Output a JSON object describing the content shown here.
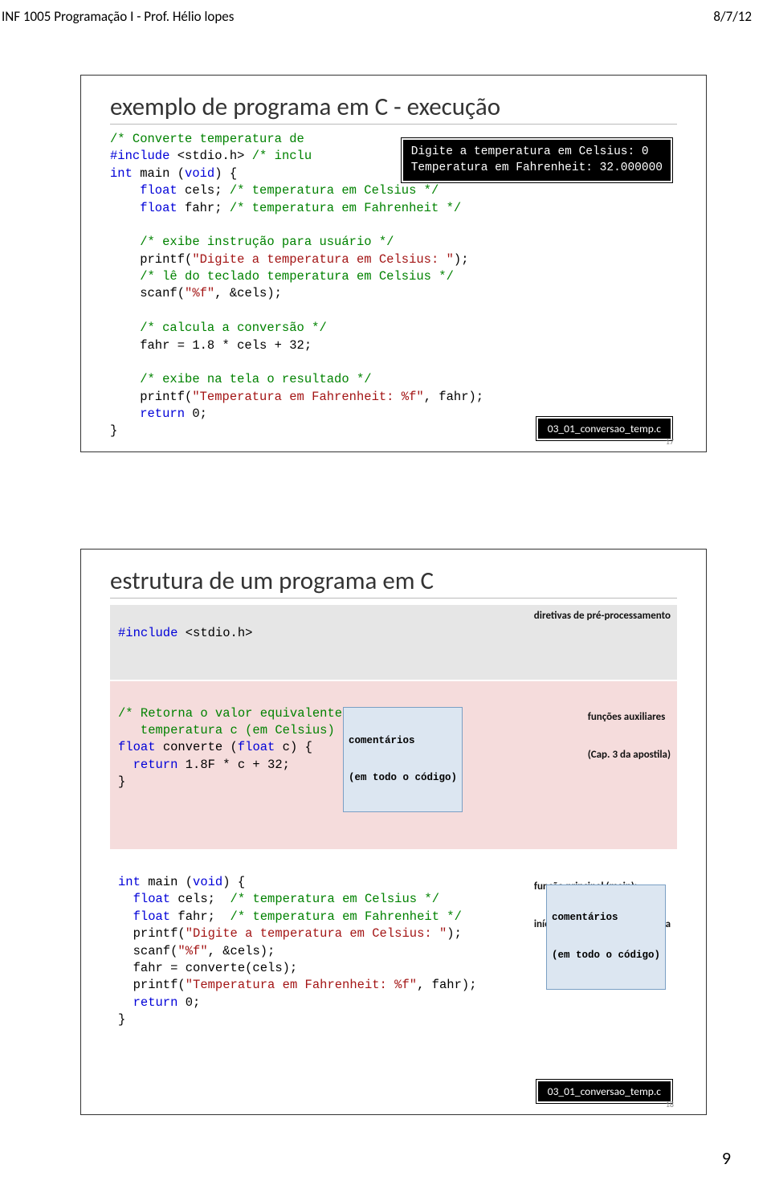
{
  "header": {
    "left": "INF 1005 Programação I - Prof. Hélio lopes",
    "right": "8/7/12"
  },
  "slide1": {
    "title": "exemplo de programa em C - execução",
    "out_line1": "Digite a temperatura em Celsius: 0",
    "out_line2": "Temperatura em Fahrenheit: 32.000000",
    "l1_cmt": "/* Converte temperatura de",
    "l2a": "#include",
    "l2b": " <stdio.h> ",
    "l2c": "/* inclu",
    "l3a": "int",
    "l3b": " main (",
    "l3c": "void",
    "l3d": ") {",
    "l4a": "    float",
    "l4b": " cels; ",
    "l4c": "/* temperatura em Celsius */",
    "l5a": "    float",
    "l5b": " fahr; ",
    "l5c": "/* temperatura em Fahrenheit */",
    "l6": " ",
    "l7": "    /* exibe instrução para usuário */",
    "l8a": "    printf(",
    "l8b": "\"Digite a temperatura em Celsius: \"",
    "l8c": ");",
    "l9": "    /* lê do teclado temperatura em Celsius */",
    "l10a": "    scanf(",
    "l10b": "\"%f\"",
    "l10c": ", &cels);",
    "l11": " ",
    "l12": "    /* calcula a conversão */",
    "l13": "    fahr = 1.8 * cels + 32;",
    "l14": " ",
    "l15": "    /* exibe na tela o resultado */",
    "l16a": "    printf(",
    "l16b": "\"Temperatura em Fahrenheit: %f\"",
    "l16c": ", fahr);",
    "l17a": "    return",
    "l17b": " 0;",
    "l18": "}",
    "fn": "03_01_conversao_temp.c",
    "pgnum": "17"
  },
  "slide2": {
    "title": "estrutura de um programa em C",
    "b1a": "#include",
    "b1b": " <stdio.h>",
    "anno1": "diretivas de pré-processamento",
    "b2_l1": "/* Retorna o valor equivalente em Fahrenheit à",
    "b2_l2": "   temperatura c (em Celsius) */",
    "b2_l3a": "float",
    "b2_l3b": " converte (",
    "b2_l3c": "float",
    "b2_l3d": " c) {",
    "b2_l4a": "  return",
    "b2_l4b": " 1.8F * c + 32;",
    "b2_l5": "}",
    "anno2_l1": "funções auxiliares",
    "anno2_l2": "(Cap. 3 da apostila)",
    "anno_com1": "comentários",
    "anno_com1b": "(em todo o código)",
    "b3_l1a": "int",
    "b3_l1b": " main (",
    "b3_l1c": "void",
    "b3_l1d": ") {",
    "b3_l2a": "  float",
    "b3_l2b": " cels;  ",
    "b3_l2c": "/* temperatura em Celsius */",
    "b3_l3a": "  float",
    "b3_l3b": " fahr;  ",
    "b3_l3c": "/* temperatura em Fahrenheit */",
    "b3_l4a": "  printf(",
    "b3_l4b": "\"Digite a temperatura em Celsius: \"",
    "b3_l4c": ");",
    "b3_l5a": "  scanf(",
    "b3_l5b": "\"%f\"",
    "b3_l5c": ", &cels);",
    "b3_l6": "  fahr = converte(cels);",
    "b3_l7a": "  printf(",
    "b3_l7b": "\"Temperatura em Fahrenheit: %f\"",
    "b3_l7c": ", fahr);",
    "b3_l8a": "  return",
    "b3_l8b": " 0;",
    "b3_l9": "}",
    "anno3_l1": "função principal (main):",
    "anno3_l2": "início da execução do programa",
    "anno_com2": "comentários",
    "anno_com2b": "(em todo o código)",
    "fn": "03_01_conversao_temp.c",
    "pgnum": "18"
  },
  "footer": {
    "pagenum": "9"
  }
}
